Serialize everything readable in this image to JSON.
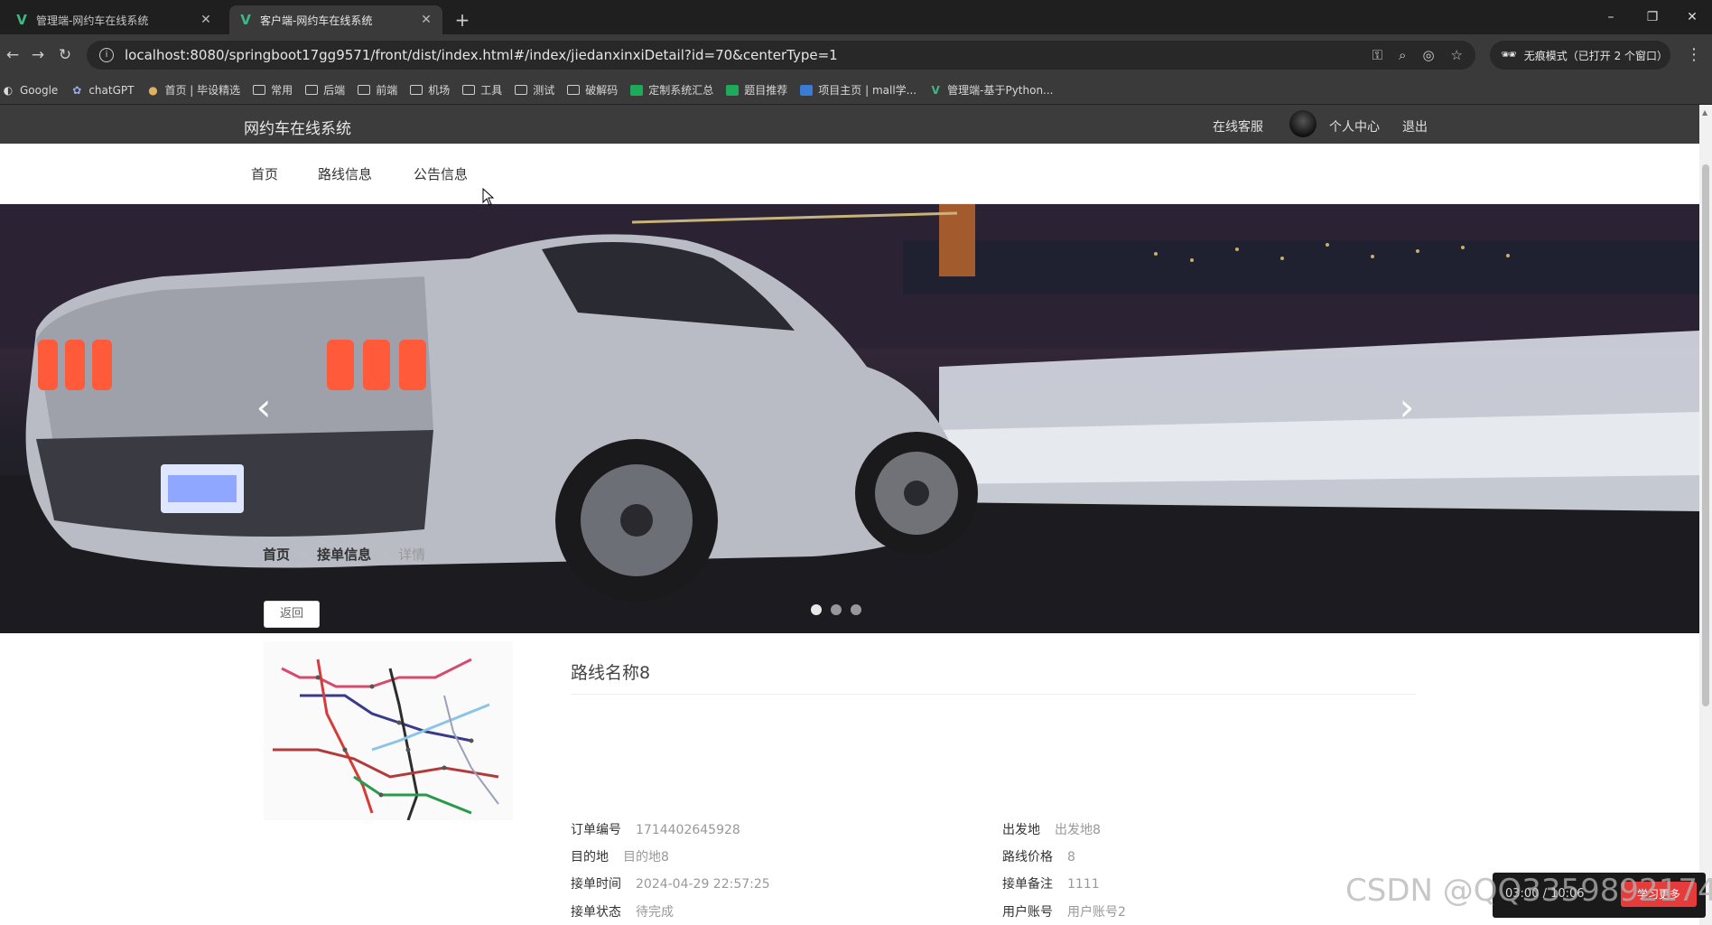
{
  "browser": {
    "tabs": [
      {
        "title": "管理端-网约车在线系统"
      },
      {
        "title": "客户端-网约车在线系统"
      }
    ],
    "url": "localhost:8080/springboot17gg9571/front/dist/index.html#/index/jiedanxinxiDetail?id=70&centerType=1",
    "incognito": "无痕模式（已打开 2 个窗口）",
    "bookmarks": [
      {
        "label": "Google",
        "icon": "google-icon"
      },
      {
        "label": "chatGPT",
        "icon": "chatgpt-icon"
      },
      {
        "label": "首页 | 毕设精选",
        "icon": "site-icon"
      },
      {
        "label": "常用",
        "icon": "folder-icon"
      },
      {
        "label": "后端",
        "icon": "folder-icon"
      },
      {
        "label": "前端",
        "icon": "folder-icon"
      },
      {
        "label": "机场",
        "icon": "folder-icon"
      },
      {
        "label": "工具",
        "icon": "folder-icon"
      },
      {
        "label": "测试",
        "icon": "folder-icon"
      },
      {
        "label": "破解码",
        "icon": "folder-icon"
      },
      {
        "label": "定制系统汇总",
        "icon": "green-doc-icon"
      },
      {
        "label": "题目推荐",
        "icon": "green-doc-icon"
      },
      {
        "label": "项目主页 | mall学...",
        "icon": "blue-page-icon"
      },
      {
        "label": "管理端-基于Python...",
        "icon": "vue-icon"
      }
    ]
  },
  "header": {
    "site_title": "网约车在线系统",
    "online_service": "在线客服",
    "personal_center": "个人中心",
    "logout": "退出"
  },
  "nav": {
    "home": "首页",
    "routes": "路线信息",
    "notices": "公告信息"
  },
  "breadcrumb": {
    "home": "首页",
    "section": "接单信息",
    "current": "详情"
  },
  "back_button": "返回",
  "detail": {
    "title": "路线名称8",
    "order_no_label": "订单编号",
    "order_no": "1714402645928",
    "origin_label": "出发地",
    "origin": "出发地8",
    "destination_label": "目的地",
    "destination": "目的地8",
    "price_label": "路线价格",
    "price": "8",
    "time_label": "接单时间",
    "time": "2024-04-29 22:57:25",
    "remark_label": "接单备注",
    "remark": "1111",
    "status_label": "接单状态",
    "status": "待完成",
    "user_label": "用户账号",
    "user": "用户账号2"
  },
  "carousel": {
    "slide_count": 3,
    "active_slide": 1
  },
  "watermark": "CSDN @QQ3359892174",
  "overlay": {
    "time": "03:00 / 10:06",
    "button": "学习更多"
  }
}
